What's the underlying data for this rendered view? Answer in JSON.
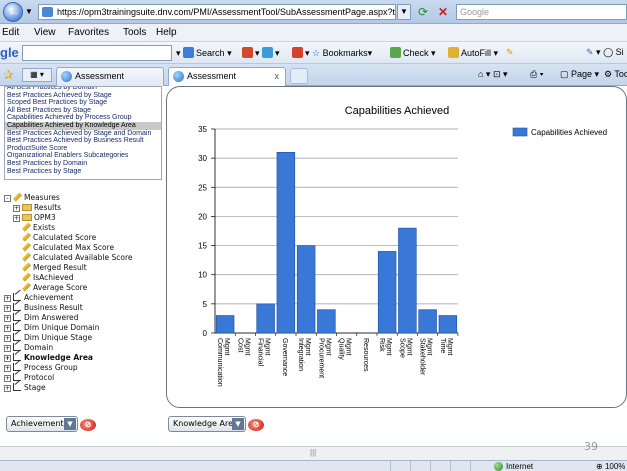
{
  "browser": {
    "url": "https://opm3trainingsuite.dnv.com/PMI/AssessmentTool/SubAssessmentPage.aspx?tab=analysis&ID=d1ec60dc-8987-49a8-",
    "search_placeholder": "Google",
    "menu": [
      "Edit",
      "View",
      "Favorites",
      "Tools",
      "Help"
    ],
    "google_toolbar": {
      "logo": "gle",
      "search": "Search",
      "bookmarks": "Bookmarks",
      "check": "Check",
      "autofill": "AutoFill",
      "right_label": "Si"
    },
    "tabs": [
      {
        "label": "Assessment",
        "active": false
      },
      {
        "label": "Assessment",
        "active": true,
        "close": "x"
      }
    ],
    "command_bar": {
      "page": "Page",
      "tools": "Too"
    }
  },
  "list_items": [
    "All Best Practices by Domain",
    "Best Practices Achieved by Stage",
    "Scoped Best Practices by Stage",
    "All Best Practices by Stage",
    "Capabilities Achieved by Process Group",
    "Capabilities Achieved by Knowledge Area",
    "Best Practices Achieved by Stage and Domain",
    "Best Practices Achieved by Business Result",
    "ProductSuite Score",
    "Organizational Enablers Subcategories",
    "Best Practices by Domain",
    "Best Practices by Stage"
  ],
  "selected_list_index": 5,
  "tree": [
    {
      "label": "Measures",
      "icon": "measures-icon",
      "indent": 0,
      "expander": "-",
      "bold": false
    },
    {
      "label": "Results",
      "icon": "folder-icon",
      "indent": 1,
      "expander": "+",
      "bold": false
    },
    {
      "label": "OPM3",
      "icon": "folder-icon",
      "indent": 1,
      "expander": "+",
      "bold": false
    },
    {
      "label": "Exists",
      "icon": "pencil-icon",
      "indent": 2,
      "expander": "",
      "bold": false
    },
    {
      "label": "Calculated Score",
      "icon": "pencil-icon",
      "indent": 2,
      "expander": "",
      "bold": false
    },
    {
      "label": "Calculated Max Score",
      "icon": "pencil-icon",
      "indent": 2,
      "expander": "",
      "bold": false
    },
    {
      "label": "Calculated Available Score",
      "icon": "pencil-icon",
      "indent": 2,
      "expander": "",
      "bold": false
    },
    {
      "label": "Merged Result",
      "icon": "pencil-icon",
      "indent": 2,
      "expander": "",
      "bold": false
    },
    {
      "label": "IsAchieved",
      "icon": "pencil-icon",
      "indent": 2,
      "expander": "",
      "bold": false
    },
    {
      "label": "Average Score",
      "icon": "pencil-icon",
      "indent": 2,
      "expander": "",
      "bold": false
    },
    {
      "label": "Achievement",
      "icon": "dimension-icon",
      "indent": 0,
      "expander": "+",
      "bold": false
    },
    {
      "label": "Business Result",
      "icon": "dimension-icon",
      "indent": 0,
      "expander": "+",
      "bold": false
    },
    {
      "label": "Dim Answered",
      "icon": "dimension-icon",
      "indent": 0,
      "expander": "+",
      "bold": false
    },
    {
      "label": "Dim Unique Domain",
      "icon": "dimension-icon",
      "indent": 0,
      "expander": "+",
      "bold": false
    },
    {
      "label": "Dim Unique Stage",
      "icon": "dimension-icon",
      "indent": 0,
      "expander": "+",
      "bold": false
    },
    {
      "label": "Domain",
      "icon": "dimension-icon",
      "indent": 0,
      "expander": "+",
      "bold": false
    },
    {
      "label": "Knowledge Area",
      "icon": "dimension-icon",
      "indent": 0,
      "expander": "+",
      "bold": true
    },
    {
      "label": "Process Group",
      "icon": "dimension-icon",
      "indent": 0,
      "expander": "+",
      "bold": false
    },
    {
      "label": "Protocol",
      "icon": "dimension-icon",
      "indent": 0,
      "expander": "+",
      "bold": false
    },
    {
      "label": "Stage",
      "icon": "dimension-icon",
      "indent": 0,
      "expander": "+",
      "bold": false
    }
  ],
  "left_combo": {
    "value": "Achievement"
  },
  "chart_combo": {
    "value": "Knowledge Area"
  },
  "page_number": "39",
  "status": {
    "internet": "Internet",
    "zoom": "100%"
  },
  "colors": {
    "bar": "#3a78d8",
    "bar_edge": "#1d4f9e",
    "selected_row": "#c9c9c9"
  },
  "chart_data": {
    "type": "bar",
    "title": "Capabilities Achieved",
    "categories": [
      "Communication Mgmt",
      "Cost Mgmt",
      "Financial Mgmt",
      "Governance",
      "Integration Mgmt",
      "Procurement Mgmt",
      "Quality Mgmt",
      "Resources",
      "Risk Mgmt",
      "Scope Mgmt",
      "Stakeholder Mgmt",
      "Time Mgmt"
    ],
    "series": [
      {
        "name": "Capabilities Achieved",
        "values": [
          3,
          0,
          5,
          31,
          15,
          4,
          0,
          0,
          14,
          18,
          4,
          3
        ]
      }
    ],
    "ylim": [
      0,
      35
    ],
    "yticks": [
      0,
      5,
      10,
      15,
      20,
      25,
      30,
      35
    ],
    "xlabel": "",
    "ylabel": "",
    "grid": true,
    "legend": "top-right"
  }
}
